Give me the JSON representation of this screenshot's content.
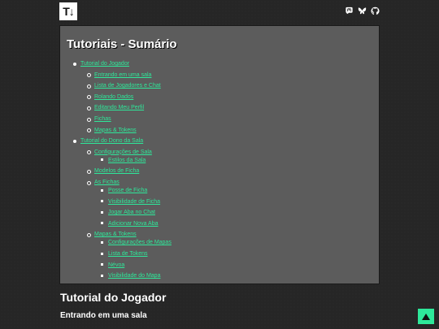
{
  "header": {
    "logo_text": "T↓",
    "social_icons": [
      "mastodon-icon",
      "bluesky-icon",
      "github-icon"
    ]
  },
  "toc": {
    "title": "Tutoriais - Sumário",
    "items": [
      {
        "label": "Tutorial do Jogador",
        "level": 1
      },
      {
        "label": "Entrando em uma sala",
        "level": 2
      },
      {
        "label": "Lista de Jogadores e Chat",
        "level": 2
      },
      {
        "label": "Rolando Dados",
        "level": 2
      },
      {
        "label": "Editando Meu Perfil",
        "level": 2
      },
      {
        "label": "Fichas",
        "level": 2
      },
      {
        "label": "Mapas & Tokens",
        "level": 2
      },
      {
        "label": "Tutorial do Dono da Sala",
        "level": 1
      },
      {
        "label": "Configurações de Sala",
        "level": 2
      },
      {
        "label": "Estilos da Sala",
        "level": 3
      },
      {
        "label": "Modelos de Ficha",
        "level": 2
      },
      {
        "label": "As Fichas",
        "level": 2
      },
      {
        "label": "Posse de Ficha",
        "level": 3
      },
      {
        "label": "Visibilidade de Ficha",
        "level": 3
      },
      {
        "label": "Jogar Aba no Chat",
        "level": 3
      },
      {
        "label": "Adicionar Nova Aba",
        "level": 3
      },
      {
        "label": "Mapas & Tokens",
        "level": 2
      },
      {
        "label": "Configurações de Mapas",
        "level": 3
      },
      {
        "label": "Lista de Tokens",
        "level": 3
      },
      {
        "label": "Névoa",
        "level": 3
      },
      {
        "label": "Visibilidade do Mapa",
        "level": 3
      }
    ]
  },
  "content": {
    "section_title": "Tutorial do Jogador",
    "subsection_title": "Entrando em uma sala"
  },
  "colors": {
    "link": "#2ee89a",
    "panel": "#5c5c5c",
    "background": "#262626"
  },
  "scroll_top_icon": "arrow-up-icon"
}
